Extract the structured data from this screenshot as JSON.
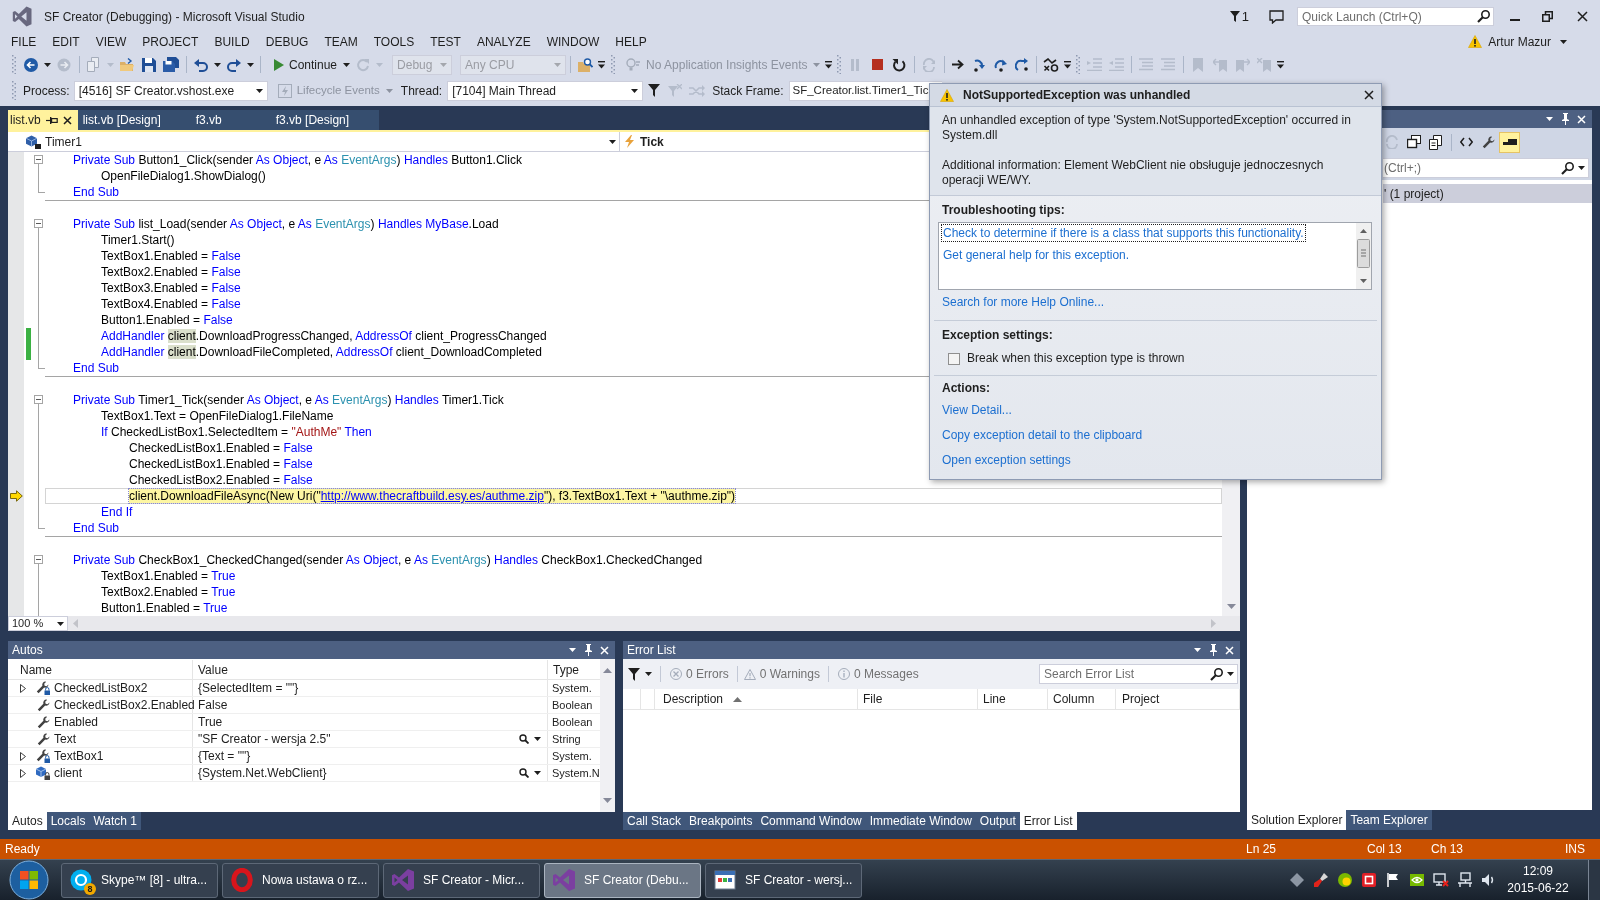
{
  "window": {
    "title": "SF Creator (Debugging) - Microsoft Visual Studio",
    "notification_count": "1",
    "quick_launch": {
      "placeholder": "Quick Launch (Ctrl+Q)"
    },
    "user": "Artur Mazur"
  },
  "menu": [
    "FILE",
    "EDIT",
    "VIEW",
    "PROJECT",
    "BUILD",
    "DEBUG",
    "TEAM",
    "TOOLS",
    "TEST",
    "ANALYZE",
    "WINDOW",
    "HELP"
  ],
  "standard_toolbar": {
    "continue": {
      "label": "Continue"
    },
    "configuration": {
      "value": "Debug",
      "disabled": true
    },
    "platform": {
      "value": "Any CPU",
      "disabled": true
    },
    "insights": {
      "label": "No Application Insights Events",
      "disabled": true
    }
  },
  "debug_location_toolbar": {
    "process": {
      "label": "Process:",
      "value": "[4516] SF Creator.vshost.exe"
    },
    "lifecycle": {
      "label": "Lifecycle Events",
      "disabled": true
    },
    "thread": {
      "label": "Thread:",
      "value": "[7104] Main Thread"
    },
    "stack_frame": {
      "label": "Stack Frame:",
      "value": "SF_Creator.list.Timer1_Tic"
    }
  },
  "editor": {
    "tabs": [
      {
        "label": "list.vb",
        "selected": true
      },
      {
        "label": "list.vb [Design]",
        "selected": false
      },
      {
        "label": "f3.vb",
        "selected": false
      },
      {
        "label": "f3.vb [Design]",
        "selected": false
      }
    ],
    "type_combo": "Timer1",
    "member_combo": "Tick",
    "methods": [
      {
        "expanded": true,
        "header": [
          {
            "kind": "keyword",
            "text": "Private Sub"
          },
          {
            "kind": "plain",
            "text": " Button1_Click(sender "
          },
          {
            "kind": "keyword",
            "text": "As Object"
          },
          {
            "kind": "plain",
            "text": ", e "
          },
          {
            "kind": "keyword",
            "text": "As"
          },
          {
            "kind": "type",
            "text": " EventArgs"
          },
          {
            "kind": "plain",
            "text": ") "
          },
          {
            "kind": "keyword",
            "text": "Handles"
          },
          {
            "kind": "plain",
            "text": " Button1.Click"
          }
        ],
        "body": [
          {
            "tokens": [
              {
                "kind": "plain",
                "text": "OpenFileDialog1.ShowDialog()"
              }
            ],
            "changed": false,
            "current": false
          }
        ],
        "footer": [
          {
            "kind": "keyword",
            "text": "End Sub"
          }
        ]
      },
      {
        "expanded": true,
        "header": [
          {
            "kind": "keyword",
            "text": "Private Sub"
          },
          {
            "kind": "plain",
            "text": " list_Load(sender "
          },
          {
            "kind": "keyword",
            "text": "As Object"
          },
          {
            "kind": "plain",
            "text": ", e "
          },
          {
            "kind": "keyword",
            "text": "As"
          },
          {
            "kind": "type",
            "text": " EventArgs"
          },
          {
            "kind": "plain",
            "text": ") "
          },
          {
            "kind": "keyword",
            "text": "Handles MyBase"
          },
          {
            "kind": "plain",
            "text": ".Load"
          }
        ],
        "body": [
          {
            "tokens": [
              {
                "kind": "plain",
                "text": "Timer1.Start()"
              }
            ],
            "changed": false,
            "current": false
          },
          {
            "tokens": [
              {
                "kind": "plain",
                "text": "TextBox1.Enabled = "
              },
              {
                "kind": "keyword",
                "text": "False"
              }
            ],
            "changed": false,
            "current": false
          },
          {
            "tokens": [
              {
                "kind": "plain",
                "text": "TextBox2.Enabled = "
              },
              {
                "kind": "keyword",
                "text": "False"
              }
            ],
            "changed": false,
            "current": false
          },
          {
            "tokens": [
              {
                "kind": "plain",
                "text": "TextBox3.Enabled = "
              },
              {
                "kind": "keyword",
                "text": "False"
              }
            ],
            "changed": false,
            "current": false
          },
          {
            "tokens": [
              {
                "kind": "plain",
                "text": "TextBox4.Enabled = "
              },
              {
                "kind": "keyword",
                "text": "False"
              }
            ],
            "changed": false,
            "current": false
          },
          {
            "tokens": [
              {
                "kind": "plain",
                "text": "Button1.Enabled = "
              },
              {
                "kind": "keyword",
                "text": "False"
              }
            ],
            "changed": false,
            "current": false
          },
          {
            "tokens": [
              {
                "kind": "keyword",
                "text": "AddHandler "
              },
              {
                "kind": "reference",
                "text": "client"
              },
              {
                "kind": "plain",
                "text": ".DownloadProgressChanged, "
              },
              {
                "kind": "keyword",
                "text": "AddressOf"
              },
              {
                "kind": "plain",
                "text": " client_ProgressChanged"
              }
            ],
            "changed": true,
            "current": false
          },
          {
            "tokens": [
              {
                "kind": "keyword",
                "text": "AddHandler "
              },
              {
                "kind": "reference",
                "text": "client"
              },
              {
                "kind": "plain",
                "text": ".DownloadFileCompleted, "
              },
              {
                "kind": "keyword",
                "text": "AddressOf"
              },
              {
                "kind": "plain",
                "text": " client_DownloadCompleted"
              }
            ],
            "changed": true,
            "current": false
          }
        ],
        "footer": [
          {
            "kind": "keyword",
            "text": "End Sub"
          }
        ]
      },
      {
        "expanded": true,
        "header": [
          {
            "kind": "keyword",
            "text": "Private Sub"
          },
          {
            "kind": "plain",
            "text": " Timer1_Tick(sender "
          },
          {
            "kind": "keyword",
            "text": "As Object"
          },
          {
            "kind": "plain",
            "text": ", e "
          },
          {
            "kind": "keyword",
            "text": "As"
          },
          {
            "kind": "type",
            "text": " EventArgs"
          },
          {
            "kind": "plain",
            "text": ") "
          },
          {
            "kind": "keyword",
            "text": "Handles"
          },
          {
            "kind": "plain",
            "text": " Timer1.Tick"
          }
        ],
        "body": [
          {
            "tokens": [
              {
                "kind": "plain",
                "text": "TextBox1.Text = OpenFileDialog1.FileName"
              }
            ],
            "changed": false,
            "current": false
          },
          {
            "tokens": [
              {
                "kind": "keyword",
                "text": "If"
              },
              {
                "kind": "plain",
                "text": " CheckedListBox1.SelectedItem = "
              },
              {
                "kind": "string",
                "text": "\"AuthMe\""
              },
              {
                "kind": "keyword",
                "text": " Then"
              }
            ],
            "changed": false,
            "current": false,
            "children": [
              {
                "tokens": [
                  {
                    "kind": "plain",
                    "text": "CheckedListBox1.Enabled = "
                  },
                  {
                    "kind": "keyword",
                    "text": "False"
                  }
                ],
                "changed": false,
                "current": false
              },
              {
                "tokens": [
                  {
                    "kind": "plain",
                    "text": "CheckedListBox1.Enabled = "
                  },
                  {
                    "kind": "keyword",
                    "text": "False"
                  }
                ],
                "changed": false,
                "current": false
              },
              {
                "tokens": [
                  {
                    "kind": "plain",
                    "text": "CheckedListBox2.Enabled = "
                  },
                  {
                    "kind": "keyword",
                    "text": "False"
                  }
                ],
                "changed": false,
                "current": false
              },
              {
                "tokens": [
                  {
                    "kind": "plain",
                    "text": "client.DownloadFileAsync(New Uri(\""
                  },
                  {
                    "kind": "link",
                    "text": "http://www.thecraftbuild.esy.es/authme.zip"
                  },
                  {
                    "kind": "plain",
                    "text": "\"), f3.TextBox1.Text + \"\\authme.zip\")"
                  }
                ],
                "changed": false,
                "current": true
              }
            ]
          },
          {
            "tokens": [
              {
                "kind": "keyword",
                "text": "End If"
              }
            ],
            "changed": false,
            "current": false
          }
        ],
        "footer": [
          {
            "kind": "keyword",
            "text": "End Sub"
          }
        ]
      },
      {
        "expanded": true,
        "header": [
          {
            "kind": "keyword",
            "text": "Private Sub"
          },
          {
            "kind": "plain",
            "text": " CheckBox1_CheckedChanged(sender "
          },
          {
            "kind": "keyword",
            "text": "As Object"
          },
          {
            "kind": "plain",
            "text": ", e "
          },
          {
            "kind": "keyword",
            "text": "As"
          },
          {
            "kind": "type",
            "text": " EventArgs"
          },
          {
            "kind": "plain",
            "text": ") "
          },
          {
            "kind": "keyword",
            "text": "Handles"
          },
          {
            "kind": "plain",
            "text": " CheckBox1.CheckedChanged"
          }
        ],
        "body": [
          {
            "tokens": [
              {
                "kind": "plain",
                "text": "TextBox1.Enabled = "
              },
              {
                "kind": "keyword",
                "text": "True"
              }
            ],
            "changed": false,
            "current": false
          },
          {
            "tokens": [
              {
                "kind": "plain",
                "text": "TextBox2.Enabled = "
              },
              {
                "kind": "keyword",
                "text": "True"
              }
            ],
            "changed": false,
            "current": false
          },
          {
            "tokens": [
              {
                "kind": "plain",
                "text": "Button1.Enabled = "
              },
              {
                "kind": "keyword",
                "text": "True"
              }
            ],
            "changed": false,
            "current": false
          }
        ]
      }
    ],
    "zoom": "100 %"
  },
  "exception_popup": {
    "title": "NotSupportedException was unhandled",
    "message": "An unhandled exception of type 'System.NotSupportedException' occurred in System.dll",
    "additional_info": "Additional information: Element WebClient nie obsługuje jednoczesnych operacji WE/WY.",
    "tips_heading": "Troubleshooting tips:",
    "tips": [
      {
        "label": "Check to determine if there is a class that supports this functionality.",
        "selected": true
      },
      {
        "label": "Get general help for this exception.",
        "selected": false
      }
    ],
    "help_link": "Search for more Help Online...",
    "settings_heading": "Exception settings:",
    "break_checkbox": {
      "label": "Break when this exception type is thrown",
      "checked": false
    },
    "actions_heading": "Actions:",
    "actions": [
      "View Detail...",
      "Copy exception detail to the clipboard",
      "Open exception settings"
    ]
  },
  "autos": {
    "title": "Autos",
    "columns": [
      "Name",
      "Value",
      "Type"
    ],
    "rows": [
      {
        "kind": "locked",
        "expandable": true,
        "visualizer": false,
        "name": "CheckedListBox2",
        "value": "{SelectedItem = \"\"}",
        "type": "System."
      },
      {
        "kind": "property",
        "expandable": false,
        "visualizer": false,
        "name": "CheckedListBox2.Enabled",
        "value": "False",
        "type": "Boolean"
      },
      {
        "kind": "property",
        "expandable": false,
        "visualizer": false,
        "name": "Enabled",
        "value": "True",
        "type": "Boolean"
      },
      {
        "kind": "property",
        "expandable": false,
        "visualizer": true,
        "name": "Text",
        "value": "\"SF Creator - wersja 2.5\"",
        "type": "String"
      },
      {
        "kind": "locked",
        "expandable": true,
        "visualizer": false,
        "name": "TextBox1",
        "value": "{Text = \"\"}",
        "type": "System."
      },
      {
        "kind": "field",
        "expandable": true,
        "visualizer": true,
        "name": "client",
        "value": "{System.Net.WebClient}",
        "type": "System.N"
      }
    ],
    "tabs": [
      {
        "label": "Autos",
        "selected": true
      },
      {
        "label": "Locals",
        "selected": false
      },
      {
        "label": "Watch 1",
        "selected": false
      }
    ]
  },
  "error_list": {
    "title": "Error List",
    "filters": [
      {
        "kind": "error",
        "label": "0 Errors"
      },
      {
        "kind": "warning",
        "label": "0 Warnings"
      },
      {
        "kind": "message",
        "label": "0 Messages"
      }
    ],
    "search": {
      "placeholder": "Search Error List"
    },
    "columns": [
      {
        "label": "Description",
        "sorted": true
      },
      {
        "label": "File",
        "sorted": false
      },
      {
        "label": "Line",
        "sorted": false
      },
      {
        "label": "Column",
        "sorted": false
      },
      {
        "label": "Project",
        "sorted": false
      }
    ],
    "tabs": [
      {
        "label": "Call Stack",
        "selected": false
      },
      {
        "label": "Breakpoints",
        "selected": false
      },
      {
        "label": "Command Window",
        "selected": false
      },
      {
        "label": "Immediate Window",
        "selected": false
      },
      {
        "label": "Output",
        "selected": false
      },
      {
        "label": "Error List",
        "selected": true
      }
    ]
  },
  "solution_explorer": {
    "preview_on": true,
    "search": {
      "placeholder": "(Ctrl+;)"
    },
    "tree": [
      {
        "label": "' (1 project)",
        "selected": true
      }
    ],
    "tabs": [
      {
        "label": "Solution Explorer",
        "selected": true
      },
      {
        "label": "Team Explorer",
        "selected": false
      }
    ]
  },
  "status_bar": {
    "message": "Ready",
    "line": "Ln 25",
    "column": "Col 13",
    "char": "Ch 13",
    "mode": "INS"
  },
  "taskbar": {
    "items": [
      {
        "kind": "skype",
        "label": "Skype™ [8] - ultra...",
        "badge": "8",
        "selected": false
      },
      {
        "kind": "opera",
        "label": "Nowa ustawa o rz...",
        "selected": false
      },
      {
        "kind": "studio",
        "label": "SF Creator - Micr...",
        "selected": false
      },
      {
        "kind": "studio",
        "label": "SF Creator (Debu...",
        "selected": true
      },
      {
        "kind": "app",
        "label": "SF Creator - wersj...",
        "selected": false
      }
    ],
    "clock": {
      "time": "12:09",
      "date": "2015-06-22"
    }
  }
}
